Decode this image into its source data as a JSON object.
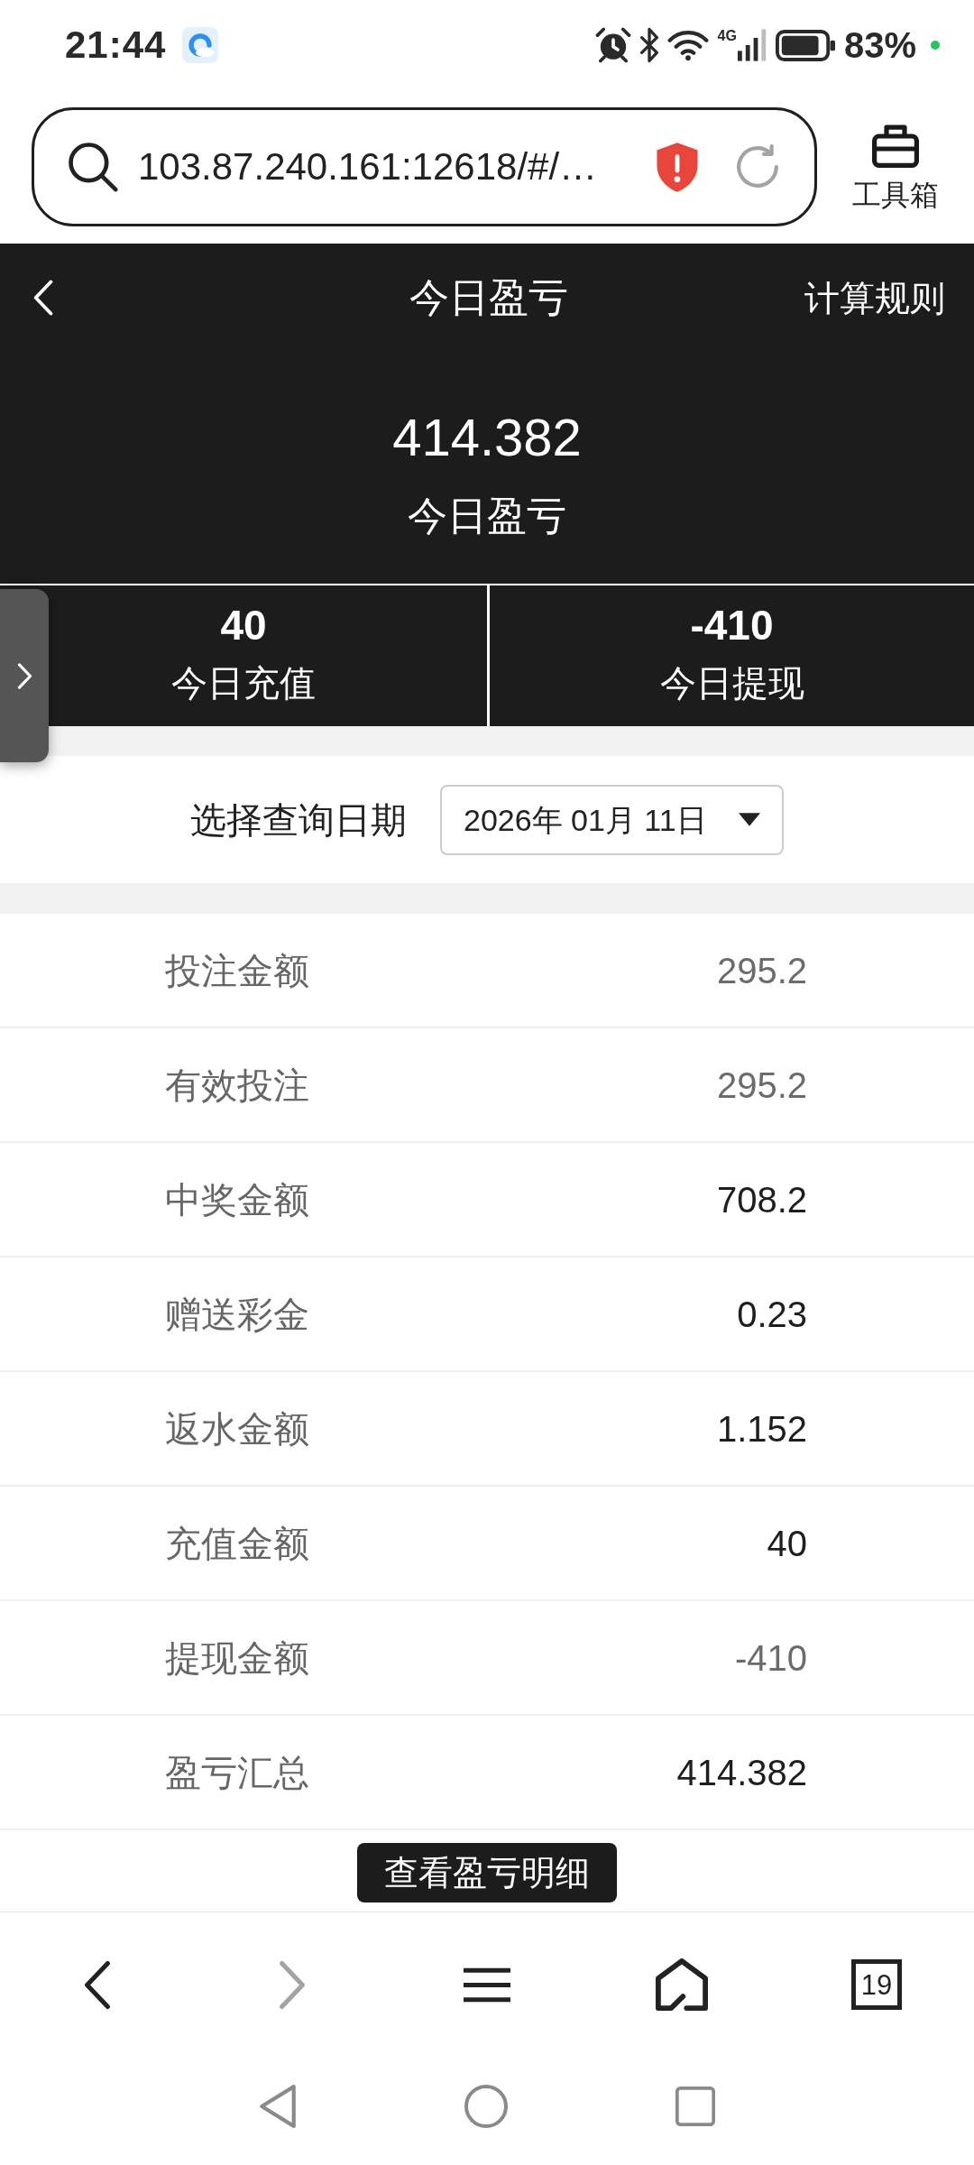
{
  "status_bar": {
    "time": "21:44",
    "network_type": "4G",
    "battery": "83%"
  },
  "address_bar": {
    "url": "103.87.240.161:12618/#/…",
    "toolbox_label": "工具箱"
  },
  "header": {
    "title": "今日盈亏",
    "rules_link": "计算规则"
  },
  "summary": {
    "value": "414.382",
    "label": "今日盈亏"
  },
  "stats": [
    {
      "value": "40",
      "label": "今日充值"
    },
    {
      "value": "-410",
      "label": "今日提现"
    }
  ],
  "date_filter": {
    "label": "选择查询日期",
    "value": "2026年 01月 11日"
  },
  "rows": [
    {
      "label": "投注金额",
      "value": "295.2",
      "muted": true
    },
    {
      "label": "有效投注",
      "value": "295.2",
      "muted": true
    },
    {
      "label": "中奖金额",
      "value": "708.2",
      "muted": false
    },
    {
      "label": "赠送彩金",
      "value": "0.23",
      "muted": false
    },
    {
      "label": "返水金额",
      "value": "1.152",
      "muted": false
    },
    {
      "label": "充值金额",
      "value": "40",
      "muted": false
    },
    {
      "label": "提现金额",
      "value": "-410",
      "muted": true
    },
    {
      "label": "盈亏汇总",
      "value": "414.382",
      "muted": false
    }
  ],
  "detail_button": {
    "label": "查看盈亏明细"
  },
  "browser_nav": [
    {
      "kind": "back",
      "disabled": false
    },
    {
      "kind": "forward",
      "disabled": true
    },
    {
      "kind": "menu",
      "disabled": false
    },
    {
      "kind": "home",
      "disabled": false
    },
    {
      "kind": "tabs",
      "count": "19",
      "disabled": false
    }
  ]
}
